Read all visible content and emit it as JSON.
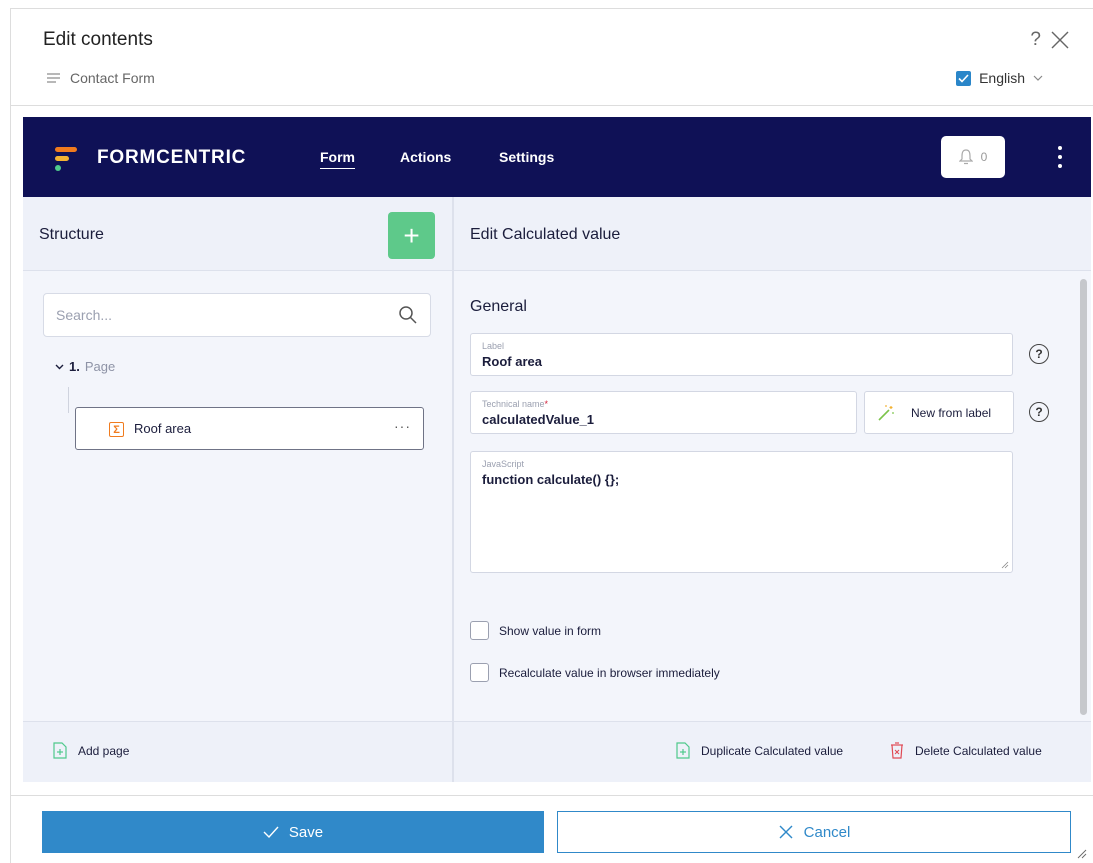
{
  "dialog": {
    "title": "Edit contents",
    "help": "?",
    "subtitle": "Contact Form",
    "language": "English"
  },
  "topbar": {
    "brand": "FORMCENTRIC",
    "nav": [
      "Form",
      "Actions",
      "Settings"
    ],
    "active_nav": "Form",
    "notifications": "0"
  },
  "structure": {
    "title": "Structure",
    "add": "+",
    "search_placeholder": "Search...",
    "page_number": "1.",
    "page_label": "Page",
    "item_label": "Roof area",
    "item_icon": "Σ",
    "item_menu": "···",
    "add_page": "Add page"
  },
  "editor": {
    "title": "Edit Calculated value",
    "section": "General",
    "label_field": {
      "label": "Label",
      "value": "Roof area"
    },
    "technical_field": {
      "label": "Technical name",
      "required": "*",
      "value": "calculatedValue_1"
    },
    "new_from_label": "New from label",
    "javascript_field": {
      "label": "JavaScript",
      "value": "function calculate() {};"
    },
    "checkboxes": [
      "Show value in form",
      "Recalculate value in browser immediately"
    ],
    "duplicate": "Duplicate Calculated value",
    "delete": "Delete Calculated value"
  },
  "buttons": {
    "save": "Save",
    "cancel": "Cancel"
  },
  "colors": {
    "topbar": "#0f1156",
    "accent": "#3089c9",
    "add_green": "#5ec98a",
    "orange": "#f07b1e",
    "red": "#e04a55"
  }
}
